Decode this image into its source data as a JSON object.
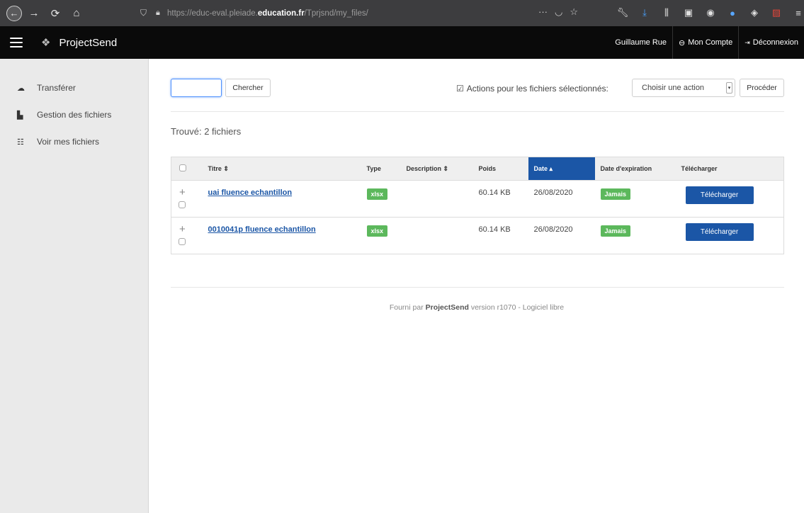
{
  "browser": {
    "url_prefix": "https://educ-eval.pleiade.",
    "url_domain": "education.fr",
    "url_path": "/Tprjsnd/my_files/"
  },
  "header": {
    "brand": "ProjectSend",
    "user_name": "Guillaume Rue",
    "account_label": "Mon Compte",
    "logout_label": "Déconnexion"
  },
  "sidebar": {
    "items": [
      {
        "label": "Transférer",
        "icon": "cloud-upload-icon"
      },
      {
        "label": "Gestion des fichiers",
        "icon": "file-icon"
      },
      {
        "label": "Voir mes fichiers",
        "icon": "list-icon"
      }
    ]
  },
  "toolbar": {
    "search_value": "",
    "search_button": "Chercher",
    "actions_label": "Actions pour les fichiers sélectionnés:",
    "actions_select": "Choisir une action",
    "proceed_button": "Procéder"
  },
  "results": {
    "found_text": "Trouvé: 2 fichiers"
  },
  "table": {
    "columns": {
      "title": "Titre ⇕",
      "type": "Type",
      "description": "Description ⇕",
      "size": "Poids",
      "date": "Date ▴",
      "expiration": "Date d'expiration",
      "download": "Télécharger"
    },
    "rows": [
      {
        "title": "uai fluence echantillon",
        "type": "xlsx",
        "description": "",
        "size": "60.14 KB",
        "date": "26/08/2020",
        "expiration": "Jamais",
        "download": "Télécharger"
      },
      {
        "title": "0010041p fluence echantillon",
        "type": "xlsx",
        "description": "",
        "size": "60.14 KB",
        "date": "26/08/2020",
        "expiration": "Jamais",
        "download": "Télécharger"
      }
    ]
  },
  "footer": {
    "prefix": "Fourni par",
    "brand": "ProjectSend",
    "suffix": "version r1070 - Logiciel libre"
  },
  "colors": {
    "primary": "#1b56a6",
    "success": "#5cb85c",
    "header_bg": "#0a0a0a",
    "sidebar_bg": "#eaeaea"
  }
}
